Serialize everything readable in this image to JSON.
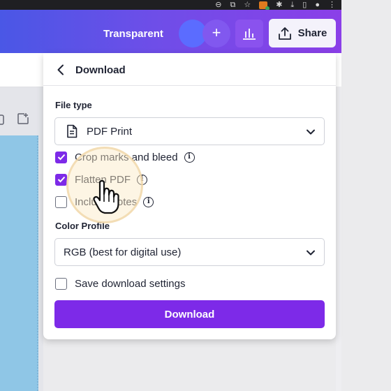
{
  "browser": {
    "icons": [
      "zoom-icon",
      "share-page-icon",
      "star-icon",
      "extension-badge-icon",
      "puzzle-icon",
      "download-icon",
      "sidebar-icon",
      "profile-icon",
      "kebab-menu-icon"
    ]
  },
  "header": {
    "transparent_label": "Transparent",
    "plus_label": "+",
    "share_label": "Share"
  },
  "download_panel": {
    "title": "Download",
    "file_type": {
      "label": "File type",
      "value": "PDF Print"
    },
    "options": [
      {
        "label": "Crop marks and bleed",
        "checked": true
      },
      {
        "label": "Flatten PDF",
        "checked": true
      },
      {
        "label": "Include notes",
        "checked": false
      }
    ],
    "color_profile": {
      "label": "Color Profile",
      "value": "RGB (best for digital use)"
    },
    "save_settings": {
      "label": "Save download settings",
      "checked": false
    },
    "download_button": "Download"
  },
  "colors": {
    "accent": "#7d2ae8",
    "header_start": "#4a57e6",
    "header_end": "#8b3fe8",
    "click_highlight": "#f0d6a6"
  }
}
